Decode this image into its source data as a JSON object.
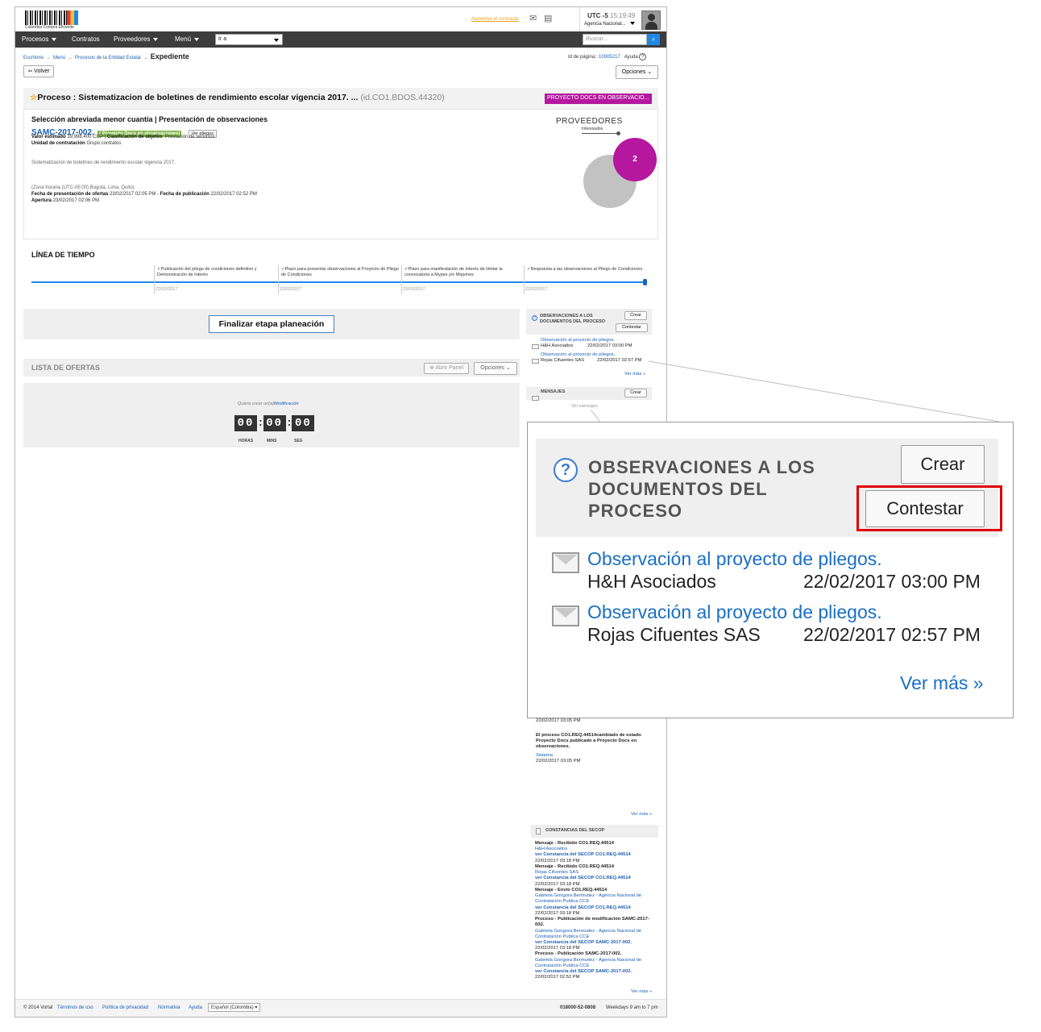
{
  "header": {
    "logo_text": "Colombia Compra Eficiente",
    "contrast_link": "Aumentar el contraste",
    "utc_label": "UTC -5",
    "time": "15:19:49",
    "agency": "Agencia Nacional..."
  },
  "nav": {
    "items": [
      "Procesos",
      "Contratos",
      "Proveedores",
      "Menú"
    ],
    "goto_value": "Ir a",
    "search_placeholder": "Buscar..."
  },
  "breadcrumb": {
    "items": [
      "Escritorio",
      "Menú",
      "Procesos de la Entidad Estatal"
    ],
    "current": "Expediente",
    "page_id_label": "Id de página::",
    "page_id": "10005217",
    "help": "Ayuda"
  },
  "actions": {
    "back": "Volver",
    "options": "Opciones"
  },
  "process": {
    "title": "Proceso : Sistematizacion de boletines de rendimiento escolar vigencia 2017. ...",
    "id": "(id.CO1.BDOS.44320)",
    "status_badge": "PROYECTO DOCS EN OBSERVACIO...",
    "type": "Selección abreviada menor cuantía | Presentación de observaciones",
    "code": "SAMC-2017-002.",
    "code_badge": "[ Proyecto Docs en observaciones]",
    "view_button": "Ver pliegos",
    "value_label": "Valor estimado",
    "value": "39.998.400 COP",
    "class_label": "Clasificación de objetos",
    "class_value": "Prestación de servicios",
    "unit_label": "Unidad de contratación",
    "unit_value": "Grupo contratos",
    "description": "Sistematización de boletines de rendimiento escolar vigencia 2017.",
    "timezone": "(Zona horaria (UTC-05:00) Bogotá, Lima, Quito)",
    "offers_date_label": "Fecha de presentación de ofertas",
    "offers_date": "23/02/2017 02:05 PM",
    "pub_label": "Fecha de publicación",
    "pub_date": "22/02/2017 02:52 PM",
    "opening_label": "Apertura",
    "opening_date": "23/02/2017 02:06 PM"
  },
  "providers": {
    "title": "PROVEEDORES",
    "subtitle": "Interesados",
    "count": "2"
  },
  "timeline": {
    "title": "LÍNEA DE TIEMPO",
    "steps": [
      {
        "label": "Publicación del pliego de condiciones definitivo y Demonstración de Interés",
        "date": "22/02/2017"
      },
      {
        "label": "Plazo para presentar observaciones al Proyecto de Pliego de Condiciones",
        "date": "22/02/2017"
      },
      {
        "label": "Plazo para manifestación de interés de limitar la convocatoria a Mypes y/o Mipymes",
        "date": "22/02/2017"
      },
      {
        "label": "Respuesta a las observaciones al Pliego de Condiciones",
        "date": "22/02/2017"
      }
    ]
  },
  "finalize_button": "Finalizar etapa planeación",
  "offers": {
    "title": "LISTA DE OFERTAS",
    "open_panel": "Abrir Panel",
    "options": "Opciones",
    "prompt": "Quiere crear un(a)",
    "prompt_link": "Modificación",
    "counter": [
      "00",
      "00",
      "00"
    ],
    "counter_labels": [
      "HORAS",
      "MINS",
      "SEG"
    ]
  },
  "observations": {
    "title": "OBSERVACIONES A LOS DOCUMENTOS DEL PROCESO",
    "title_lines": [
      "OBSERVACIONES A LOS",
      "DOCUMENTOS DEL",
      "PROCESO"
    ],
    "create": "Crear",
    "answer": "Contestar",
    "items": [
      {
        "subject": "Observación al proyecto de pliegos.",
        "author": "H&H Asociados",
        "date": "22/02/2017 03:00 PM"
      },
      {
        "subject": "Observación al proyecto de pliegos.",
        "author": "Rojas Cifuentes SAS",
        "date": "22/02/2017 02:57 PM"
      }
    ],
    "more": "Ver más »"
  },
  "messages": {
    "title": "MENSAJES",
    "create": "Crear",
    "empty": "Sin mensajes"
  },
  "activity": {
    "date1": "22/02/2017 03:05 PM",
    "event": "El proceso CO1.REQ.44514cambiado de estado Proyecto Docs publicado a Proyecto Docs en observaciones.",
    "actor": "Sistema",
    "date2": "22/02/2017 03:05 PM",
    "more": "Ver más »"
  },
  "constancias": {
    "title": "CONSTANCIAS DEL SECOP",
    "entries": [
      {
        "event": "Mensaje - Recibido CO1.REQ.44514",
        "actor": "H&H Asociados",
        "link": "ver Constancia del SECOP CO1.REQ.44514",
        "date": "22/02/2017 03:18 PM"
      },
      {
        "event": "Mensaje - Recibido CO1.REQ.44514",
        "actor": "Rojas Cifuentes SAS",
        "link": "ver Constancia del SECOP CO1.REQ.44514",
        "date": "22/02/2017 03:18 PM"
      },
      {
        "event": "Mensaje - Envío CO1.REQ.44514",
        "actor": "Gabriela Gongora Bermudez - Agencia Nacional de Contratación Publica CCE",
        "link": "ver Constancia del SECOP CO1.REQ.44514",
        "date": "22/02/2017 03:18 PM"
      },
      {
        "event": "Proceso - Publicación de modificación SAMC-2017-002.",
        "actor": "Gabriela Gongora Bermudez - Agencia Nacional de Contratación Publica CCE",
        "link": "ver Constancia del SECOP SAMC-2017-002.",
        "date": "22/02/2017 03:18 PM"
      },
      {
        "event": "Proceso - Publicación SAMC-2017-002.",
        "actor": "Gabriela Gongora Bermudez - Agencia Nacional de Contratación Publica CCE",
        "link": "ver Constancia del SECOP SAMC-2017-002.",
        "date": "22/02/2017 02:52 PM"
      }
    ],
    "more": "Ver más »"
  },
  "footer": {
    "copyright": "© 2014 Vortal",
    "links": [
      "Términos de uso",
      "Política de privacidad",
      "Normativa",
      "Ayuda"
    ],
    "language": "Español (Colombia)",
    "phone": "018000-52-0808",
    "hours": "Weekdays 9 am to 7 pm"
  },
  "colors": {
    "accent": "#1e88e5",
    "status_badge": "#b5179e",
    "code_badge": "#7cb342",
    "highlight": "#e00000",
    "nav": "#3d3d3d"
  }
}
